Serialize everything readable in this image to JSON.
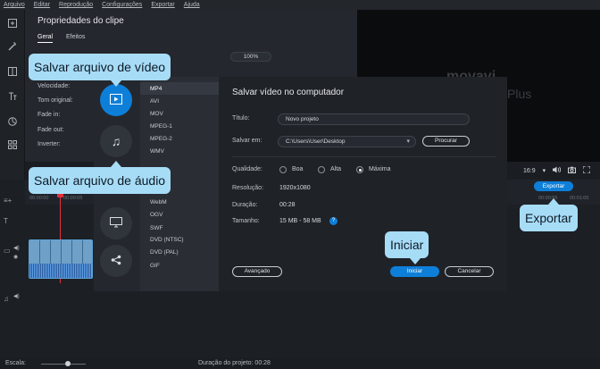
{
  "menubar": {
    "items": [
      "Arquivo",
      "Editar",
      "Reprodução",
      "Configurações",
      "Exportar",
      "Ajuda"
    ]
  },
  "clip_properties": {
    "title": "Propriedades do clipe",
    "tabs": [
      "Geral",
      "Efeitos"
    ],
    "labels": [
      "Velocidade:",
      "Tom original:",
      "Fade in:",
      "Fade out:",
      "Inverter:"
    ],
    "percent": "100%"
  },
  "preview": {
    "logo": "movavi",
    "plus": "Plus"
  },
  "player": {
    "aspect": "16:9"
  },
  "timeline": {
    "ruler": [
      "00:00:00",
      "00:00:05"
    ],
    "ruler_right": [
      "00:00:55",
      "00:01:00"
    ],
    "export_label": "Exportar"
  },
  "statusbar": {
    "scale_label": "Escala:",
    "duration": "Duração do projeto: 00:28"
  },
  "export_dialog": {
    "formats": [
      "MP4",
      "AVI",
      "MOV",
      "MPEG-1",
      "MPEG-2",
      "WMV",
      "MPG",
      "WebM",
      "OGV",
      "SWF",
      "DVD (NTSC)",
      "DVD (PAL)",
      "GIF"
    ],
    "selected_format": "MP4",
    "title": "Salvar vídeo no computador",
    "fields": {
      "title_label": "Título:",
      "title_value": "Novo projeto",
      "save_label": "Salvar em:",
      "save_value": "C:\\Users\\User\\Desktop",
      "browse": "Procurar"
    },
    "quality": {
      "label": "Qualidade:",
      "options": [
        "Boa",
        "Alta",
        "Máxima"
      ],
      "selected": "Máxima"
    },
    "resolution": {
      "label": "Resolução:",
      "value": "1920x1080"
    },
    "duration": {
      "label": "Duração:",
      "value": "00:28"
    },
    "size": {
      "label": "Tamanho:",
      "value": "15 MB - 58 MB"
    },
    "buttons": {
      "advanced": "Avançado",
      "start": "Iniciar",
      "cancel": "Cancelar"
    }
  },
  "callouts": {
    "save_video": "Salvar arquivo de vídeo",
    "save_audio": "Salvar arquivo de áudio",
    "export": "Exportar",
    "start": "Iniciar"
  },
  "colors": {
    "accent": "#0e7fd9",
    "callout": "#a7dcf7",
    "playhead": "#e2313b"
  }
}
